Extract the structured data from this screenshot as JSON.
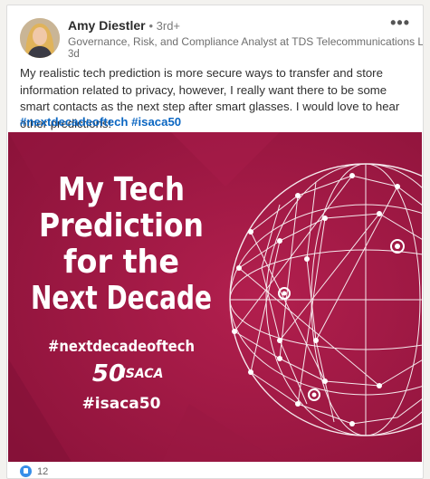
{
  "author": {
    "name": "Amy Diestler",
    "degree": "• 3rd+",
    "headline": "Governance, Risk, and Compliance Analyst at TDS Telecommunications LLC",
    "time": "3d"
  },
  "menu": {
    "more_label": "•••"
  },
  "post": {
    "text": "My realistic tech prediction is more secure ways to transfer and store information related to privacy, however, I really want there to be some smart contacts as the next step after smart glasses. I would love to hear other predictions!",
    "hashtags": [
      "#nextdecadeoftech",
      "#isaca50"
    ]
  },
  "image": {
    "headline_lines": [
      "My Tech",
      "Prediction",
      "for the",
      "Next Decade"
    ],
    "hashtag": "#nextdecadeoftech",
    "logo_text": "ISACA",
    "logo_number": "50",
    "footer_tag": "#isaca50",
    "colors": {
      "background": "#a01844",
      "text": "#ffffff"
    }
  },
  "social": {
    "reaction_count": "12",
    "reaction_icon": "like-icon"
  }
}
